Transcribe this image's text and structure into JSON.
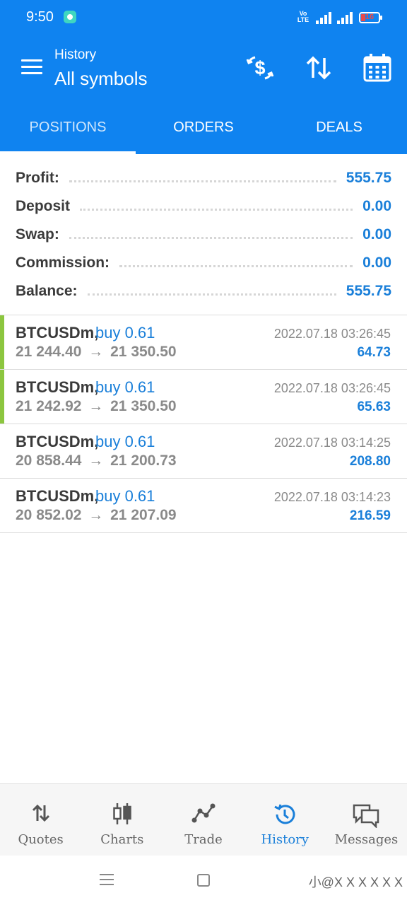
{
  "status_bar": {
    "time": "9:50",
    "network_label": "VoLTE",
    "battery": "16",
    "icons": [
      "app-notification-icon",
      "signal-icon",
      "signal-icon",
      "battery-icon"
    ]
  },
  "app_bar": {
    "subtitle": "History",
    "title": "All symbols",
    "icons": [
      "menu-icon",
      "dollar-exchange-icon",
      "sort-icon",
      "calendar-icon"
    ]
  },
  "tabs": [
    {
      "label": "POSITIONS",
      "active": true
    },
    {
      "label": "ORDERS",
      "active": false
    },
    {
      "label": "DEALS",
      "active": false
    }
  ],
  "summary": [
    {
      "label": "Profit:",
      "value": "555.75"
    },
    {
      "label": "Deposit",
      "value": "0.00"
    },
    {
      "label": "Swap:",
      "value": "0.00"
    },
    {
      "label": "Commission:",
      "value": "0.00"
    },
    {
      "label": "Balance:",
      "value": "555.75"
    }
  ],
  "deals": [
    {
      "symbol": "BTCUSDm,",
      "side": "buy 0.61",
      "open_price": "21 244.40",
      "arrow": "→",
      "close_price": "21 350.50",
      "time": "2022.07.18 03:26:45",
      "profit": "64.73",
      "marked": true
    },
    {
      "symbol": "BTCUSDm,",
      "side": "buy 0.61",
      "open_price": "21 242.92",
      "arrow": "→",
      "close_price": "21 350.50",
      "time": "2022.07.18 03:26:45",
      "profit": "65.63",
      "marked": true
    },
    {
      "symbol": "BTCUSDm,",
      "side": "buy 0.61",
      "open_price": "20 858.44",
      "arrow": "→",
      "close_price": "21 200.73",
      "time": "2022.07.18 03:14:25",
      "profit": "208.80",
      "marked": false
    },
    {
      "symbol": "BTCUSDm,",
      "side": "buy 0.61",
      "open_price": "20 852.02",
      "arrow": "→",
      "close_price": "21 207.09",
      "time": "2022.07.18 03:14:23",
      "profit": "216.59",
      "marked": false
    }
  ],
  "bottom_nav": [
    {
      "label": "Quotes",
      "icon": "quotes-icon",
      "active": false
    },
    {
      "label": "Charts",
      "icon": "charts-icon",
      "active": false
    },
    {
      "label": "Trade",
      "icon": "trade-icon",
      "active": false
    },
    {
      "label": "History",
      "icon": "history-icon",
      "active": true
    },
    {
      "label": "Messages",
      "icon": "messages-icon",
      "active": false
    }
  ],
  "watermark": "小@X X X X X X",
  "colors": {
    "primary": "#0f83f0",
    "accent_text": "#1a7fd9",
    "buy_marker": "#8cc63f",
    "muted_text": "#8a8a8a"
  }
}
